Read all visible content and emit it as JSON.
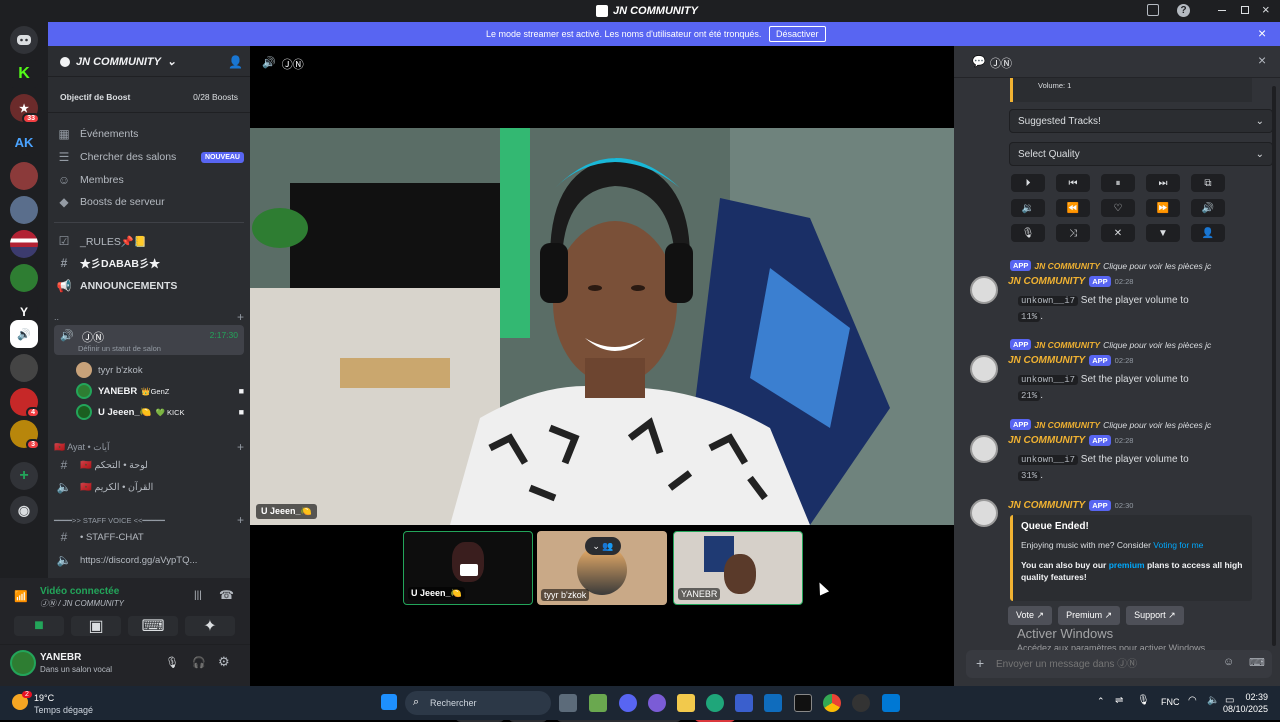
{
  "titlebar": {
    "title": "JN COMMUNITY"
  },
  "banner": {
    "text": "Le mode streamer est activé. Les noms d'utilisateur ont été tronqués.",
    "button": "Désactiver"
  },
  "guilds": {
    "badges": [
      "33",
      "4",
      "3"
    ],
    "letter_y": "Y"
  },
  "server": {
    "name": "JN COMMUNITY",
    "boost_goal": "Objectif de Boost",
    "boost_count": "0/28 Boosts",
    "menu": [
      {
        "icon": "calendar-icon",
        "label": "Événements"
      },
      {
        "icon": "search-channels-icon",
        "label": "Chercher des salons",
        "badge": "NOUVEAU"
      },
      {
        "icon": "members-icon",
        "label": "Membres"
      },
      {
        "icon": "boost-icon",
        "label": "Boosts de serveur"
      }
    ],
    "channels_top": [
      {
        "icon": "rules-icon",
        "label": "_RULES📌📒"
      },
      {
        "icon": "hash-icon",
        "label": "★彡DABAB彡★"
      },
      {
        "icon": "announce-icon",
        "label": "ANNOUNCEMENTS"
      }
    ],
    "category_dots": "..",
    "voice_channel": {
      "name": "ⒿⓃ",
      "timer": "2:17:30",
      "status": "Définir un statut de salon"
    },
    "voice_users": [
      {
        "name": "tyyr b'zkok",
        "tag": ""
      },
      {
        "name": "YANEBR",
        "tag": "👑GenZ"
      },
      {
        "name": "U Jeeen_🍋",
        "tag": "💚 KICK"
      }
    ],
    "category_ayat": "🇲🇦 Ayat • آيات",
    "arabic_channels": [
      "🇲🇦 لوحة • التحكم",
      "🇲🇦 القرآن • الكريم"
    ],
    "staff_category": "━━━━>> STAFF VOICE <<━━━━━",
    "staff_chat": "• STAFF-CHAT",
    "link_channel": "https://discord.gg/aVypTQ..."
  },
  "connection": {
    "status": "Vidéo connectée",
    "location": "ⒿⓃ / JN COMMUNITY"
  },
  "user": {
    "name": "YANEBR",
    "status": "Dans un salon vocal"
  },
  "stage": {
    "header": "ⒿⓃ",
    "main_label": "U Jeeen_🍋",
    "tiles": [
      {
        "label": "U Jeeen_🍋"
      },
      {
        "label": "tyyr b'zkok"
      },
      {
        "label": "YANEBR"
      }
    ]
  },
  "right": {
    "header": "ⒿⓃ",
    "volume_line": "Volume: 1",
    "suggested": "Suggested Tracks!",
    "quality": "Select Quality",
    "messages": [
      {
        "reply_bot": "JN COMMUNITY",
        "reply_text": "Clique pour voir les pièces jc",
        "bot": "JN COMMUNITY",
        "app": "APP",
        "time": "02:28",
        "user": "unkown__i7",
        "text": "Set the player volume to",
        "value": "11%"
      },
      {
        "reply_bot": "JN COMMUNITY",
        "reply_text": "Clique pour voir les pièces jc",
        "bot": "JN COMMUNITY",
        "app": "APP",
        "time": "02:28",
        "user": "unkown__i7",
        "text": "Set the player volume to",
        "value": "21%"
      },
      {
        "reply_bot": "JN COMMUNITY",
        "reply_text": "Clique pour voir les pièces jc",
        "bot": "JN COMMUNITY",
        "app": "APP",
        "time": "02:28",
        "user": "unkown__i7",
        "text": "Set the player volume to",
        "value": "31%"
      }
    ],
    "last": {
      "bot": "JN COMMUNITY",
      "app": "APP",
      "time": "02:30",
      "embed_title": "Queue Ended!",
      "embed_line1": "Enjoying music with me? Consider",
      "embed_link1": "Voting for me",
      "embed_line2a": "You can also buy our",
      "embed_link2": "premium",
      "embed_line2b": "plans to access all high quality features!",
      "buttons": [
        "Vote",
        "Premium",
        "Support"
      ]
    },
    "watermark_title": "Activer Windows",
    "watermark_sub": "Accédez aux paramètres pour activer Windows.",
    "input_placeholder": "Envoyer un message dans ⒿⓃ"
  },
  "taskbar": {
    "temp": "19°C",
    "weather": "Temps dégagé",
    "search": "Rechercher",
    "lang": "FNC",
    "time": "02:39",
    "date": "08/10/2025",
    "notif": "2"
  },
  "colors": {
    "blurple": "#5865f2",
    "green": "#23a55a",
    "red": "#da373c",
    "gold": "#f0b232"
  }
}
